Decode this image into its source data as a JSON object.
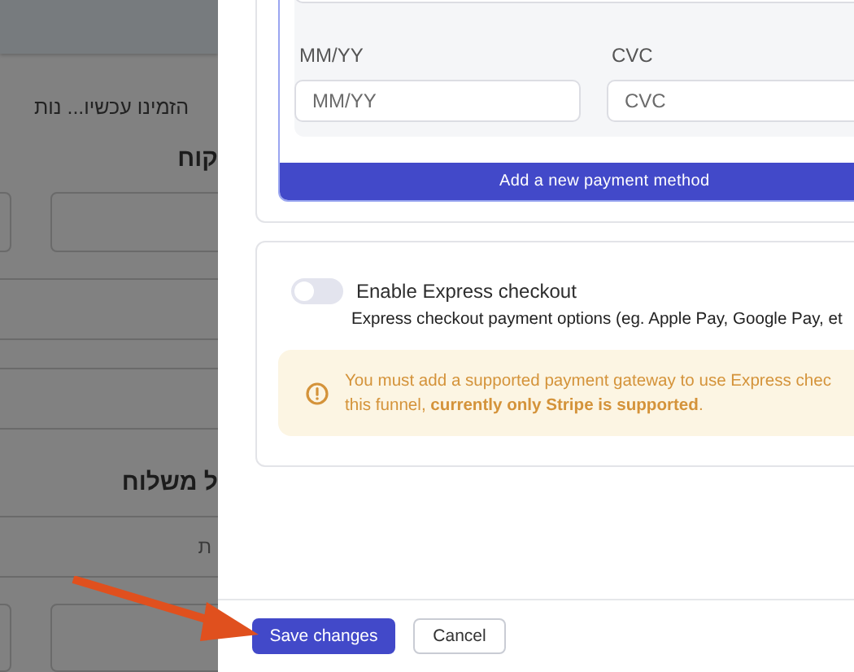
{
  "background_page": {
    "notice": "הזמינו עכשיו... נות",
    "heading_1": "קוח",
    "heading_2": "ל משלוח",
    "placeholder": "ת"
  },
  "payment_card": {
    "fields": [
      {
        "label": "MM/YY",
        "placeholder": "MM/YY"
      },
      {
        "label": "CVC",
        "placeholder": "CVC"
      }
    ],
    "add_button": "Add a new payment method"
  },
  "express_checkout": {
    "on": false,
    "label": "Enable Express checkout",
    "description": "Express checkout payment options (eg. Apple Pay, Google Pay, et",
    "warning_lines": [
      "You must add a supported payment gateway to use Express chec",
      "this funnel, **currently only Stripe is supported**."
    ]
  },
  "footer": {
    "save": "Save changes",
    "cancel": "Cancel"
  }
}
